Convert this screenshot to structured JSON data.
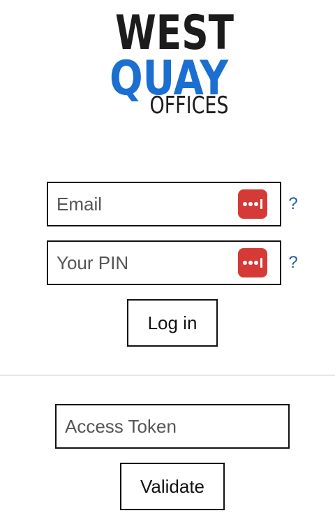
{
  "logo": {
    "line1": "WEST",
    "line2": "QUAY",
    "line3": "OFFICES",
    "colors": {
      "dark": "#1c1c1c",
      "blue": "#1a6fd0"
    }
  },
  "login": {
    "email_placeholder": "Email",
    "pin_placeholder": "Your PIN",
    "help_label": "?",
    "submit_label": "Log in",
    "password_manager_icon": "lastpass-icon"
  },
  "token": {
    "placeholder": "Access Token",
    "submit_label": "Validate"
  },
  "colors": {
    "password_manager": "#d63a37",
    "help_link": "#1d5fa8"
  }
}
